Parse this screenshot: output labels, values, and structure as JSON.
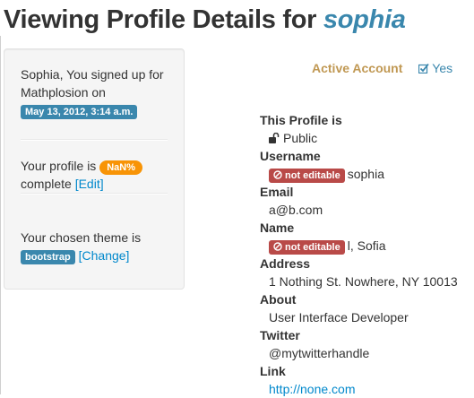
{
  "header": {
    "title_prefix": "Viewing Profile Details for",
    "username": "sophia"
  },
  "sidebar": {
    "signup_text": "Sophia, You signed up for Mathplosion on",
    "signup_date": "May 13, 2012, 3:14 a.m.",
    "profile_text_before": "Your profile is",
    "profile_percent": "NaN%",
    "profile_text_after": "complete",
    "edit_link": "[Edit]",
    "theme_text": "Your chosen theme is",
    "theme_name": "bootstrap",
    "change_link": "[Change]"
  },
  "status": {
    "label": "Active Account",
    "value": "Yes"
  },
  "details": {
    "profile_is_label": "This Profile is",
    "profile_is_value": "Public",
    "username_label": "Username",
    "not_editable": "not editable",
    "username_value": "sophia",
    "email_label": "Email",
    "email_value": "a@b.com",
    "name_label": "Name",
    "name_value": "l, Sofia",
    "address_label": "Address",
    "address_value": "1 Nothing St. Nowhere, NY 10013",
    "about_label": "About",
    "about_value": "User Interface Developer",
    "twitter_label": "Twitter",
    "twitter_value": "@mytwitterhandle",
    "link_label": "Link",
    "link_value": "http://none.com"
  },
  "colors": {
    "info": "#3a87ad",
    "warning": "#f89406",
    "danger": "#b94a48",
    "link": "#0088cc",
    "active_account": "#c09853"
  }
}
